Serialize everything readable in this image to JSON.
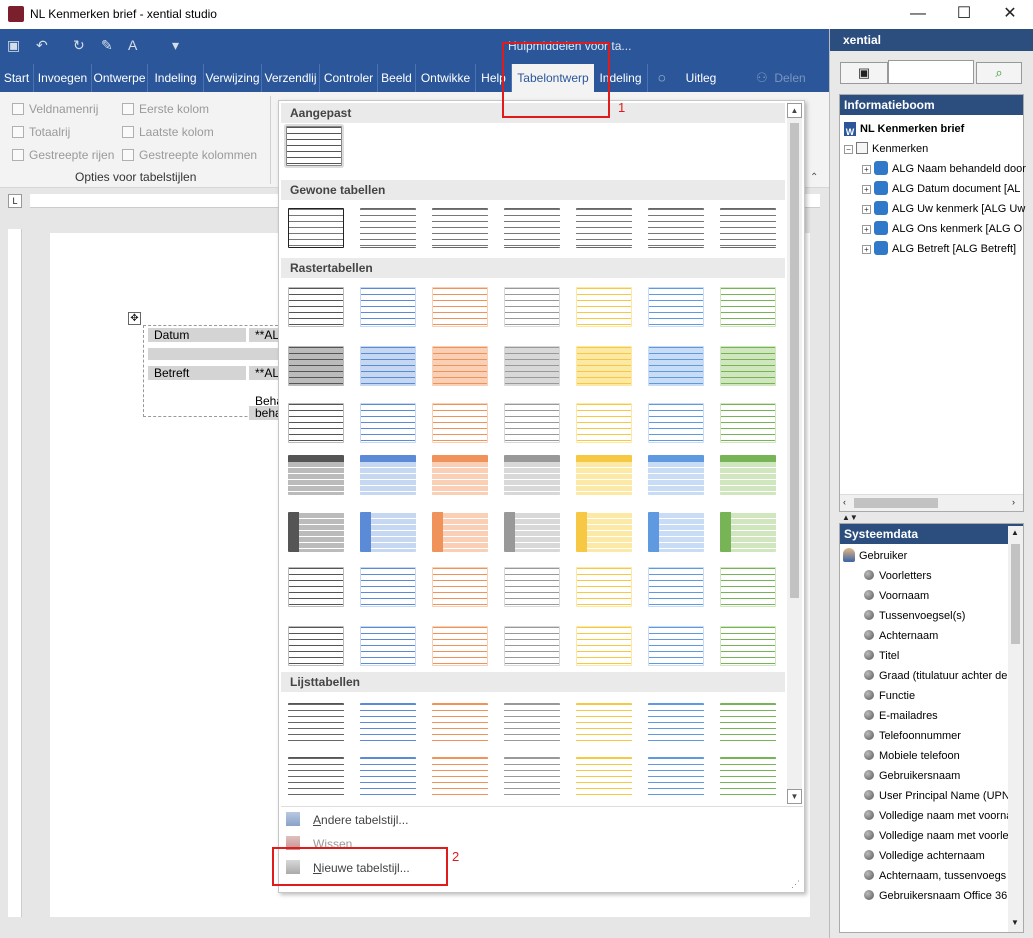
{
  "window": {
    "title": "NL Kenmerken brief - xential studio",
    "min": "—",
    "max": "☐",
    "close": "✕"
  },
  "qat": {
    "context_label": "Hulpmiddelen voor ta..."
  },
  "tabs": [
    {
      "label": "Start"
    },
    {
      "label": "Invoegen"
    },
    {
      "label": "Ontwerpe"
    },
    {
      "label": "Indeling"
    },
    {
      "label": "Verwijzing"
    },
    {
      "label": "Verzendlij"
    },
    {
      "label": "Controler"
    },
    {
      "label": "Beeld"
    },
    {
      "label": "Ontwikke"
    },
    {
      "label": "Help"
    },
    {
      "label": "Tabelontwerp"
    },
    {
      "label": "Indeling"
    },
    {
      "label": "Uitleg"
    },
    {
      "label": "Delen"
    }
  ],
  "ribbon": {
    "options": [
      "Veldnamenrij",
      "Eerste kolom",
      "Totaalrij",
      "Laatste kolom",
      "Gestreepte rijen",
      "Gestreepte kolommen"
    ],
    "group_label": "Opties voor tabelstijlen"
  },
  "doc": {
    "cells": [
      "Datum",
      "**AL",
      "Betreft",
      "**AL",
      "Beha",
      "beha"
    ]
  },
  "gallery": {
    "sections": [
      "Aangepast",
      "Gewone tabellen",
      "Rastertabellen",
      "Lijsttabellen"
    ],
    "menu": {
      "other": "Andere tabelstijl...",
      "other_u": "A",
      "clear": "Wissen",
      "new": "Nieuwe tabelstijl...",
      "new_u": "N"
    }
  },
  "annotations": {
    "one": "1",
    "two": "2"
  },
  "pane": {
    "title": "xential",
    "info_title": "Informatieboom",
    "tree_root": "NL Kenmerken brief",
    "tree_group": "Kenmerken",
    "tree_items": [
      "ALG Naam behandeld door",
      "ALG Datum document [AL",
      "ALG Uw kenmerk [ALG Uw",
      "ALG Ons kenmerk [ALG O",
      "ALG Betreft [ALG Betreft]"
    ],
    "sys_title": "Systeemdata",
    "sys_root": "Gebruiker",
    "sys_items": [
      "Voorletters",
      "Voornaam",
      "Tussenvoegsel(s)",
      "Achternaam",
      "Titel",
      "Graad (titulatuur achter de",
      "Functie",
      "E-mailadres",
      "Telefoonnummer",
      "Mobiele telefoon",
      "Gebruikersnaam",
      "User Principal Name (UPN)",
      "Volledige naam met voorna",
      "Volledige naam met voorle",
      "Volledige achternaam",
      "Achternaam, tussenvoegs",
      "Gebruikersnaam Office 36"
    ]
  },
  "colors": {
    "accent": "#2b579a",
    "pane_header": "#2b4e7e",
    "highlight": "#e01b1b"
  }
}
